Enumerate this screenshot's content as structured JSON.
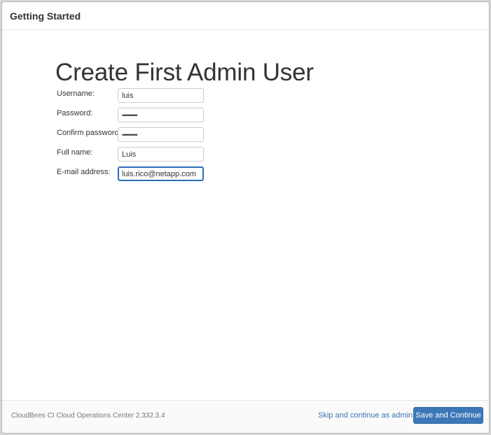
{
  "dialog": {
    "title": "Getting Started"
  },
  "main": {
    "heading": "Create First Admin User",
    "fields": [
      {
        "label": "Username:",
        "value": "luis",
        "type": "text"
      },
      {
        "label": "Password:",
        "value": "••••••••••",
        "type": "password"
      },
      {
        "label": "Confirm password:",
        "value": "••••••••••",
        "type": "password"
      },
      {
        "label": "Full name:",
        "value": "Luis",
        "type": "text"
      },
      {
        "label": "E-mail address:",
        "value": "luis.rico@netapp.com",
        "type": "text",
        "focused": true
      }
    ]
  },
  "footer": {
    "version": "CloudBees CI Cloud Operations Center 2.332.3.4",
    "skip_label": "Skip and continue as admin",
    "save_label": "Save and Continue"
  },
  "colors": {
    "primary_button": "#3c78b8",
    "link": "#3a74b6",
    "focus_border": "#2d6db5"
  }
}
